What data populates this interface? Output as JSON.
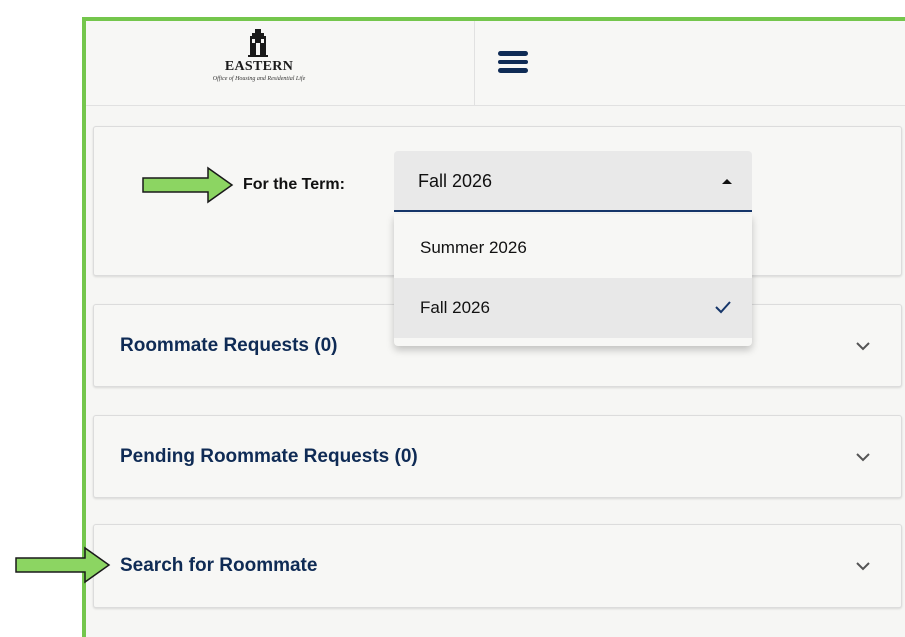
{
  "header": {
    "logo_name": "EASTERN",
    "logo_subtitle": "Office of Housing and Residential Life",
    "menu_icon": "hamburger-icon"
  },
  "term": {
    "label": "For the Term:",
    "selected": "Fall 2026",
    "options": [
      {
        "label": "Summer 2026",
        "selected": false
      },
      {
        "label": "Fall 2026",
        "selected": true
      }
    ]
  },
  "sections": [
    {
      "title": "Roommate Requests (0)"
    },
    {
      "title": "Pending Roommate Requests (0)"
    },
    {
      "title": "Search for Roommate"
    }
  ],
  "colors": {
    "accent": "#0f2b55",
    "frame_green": "#74c64c",
    "arrow_fill": "#8cd562"
  }
}
